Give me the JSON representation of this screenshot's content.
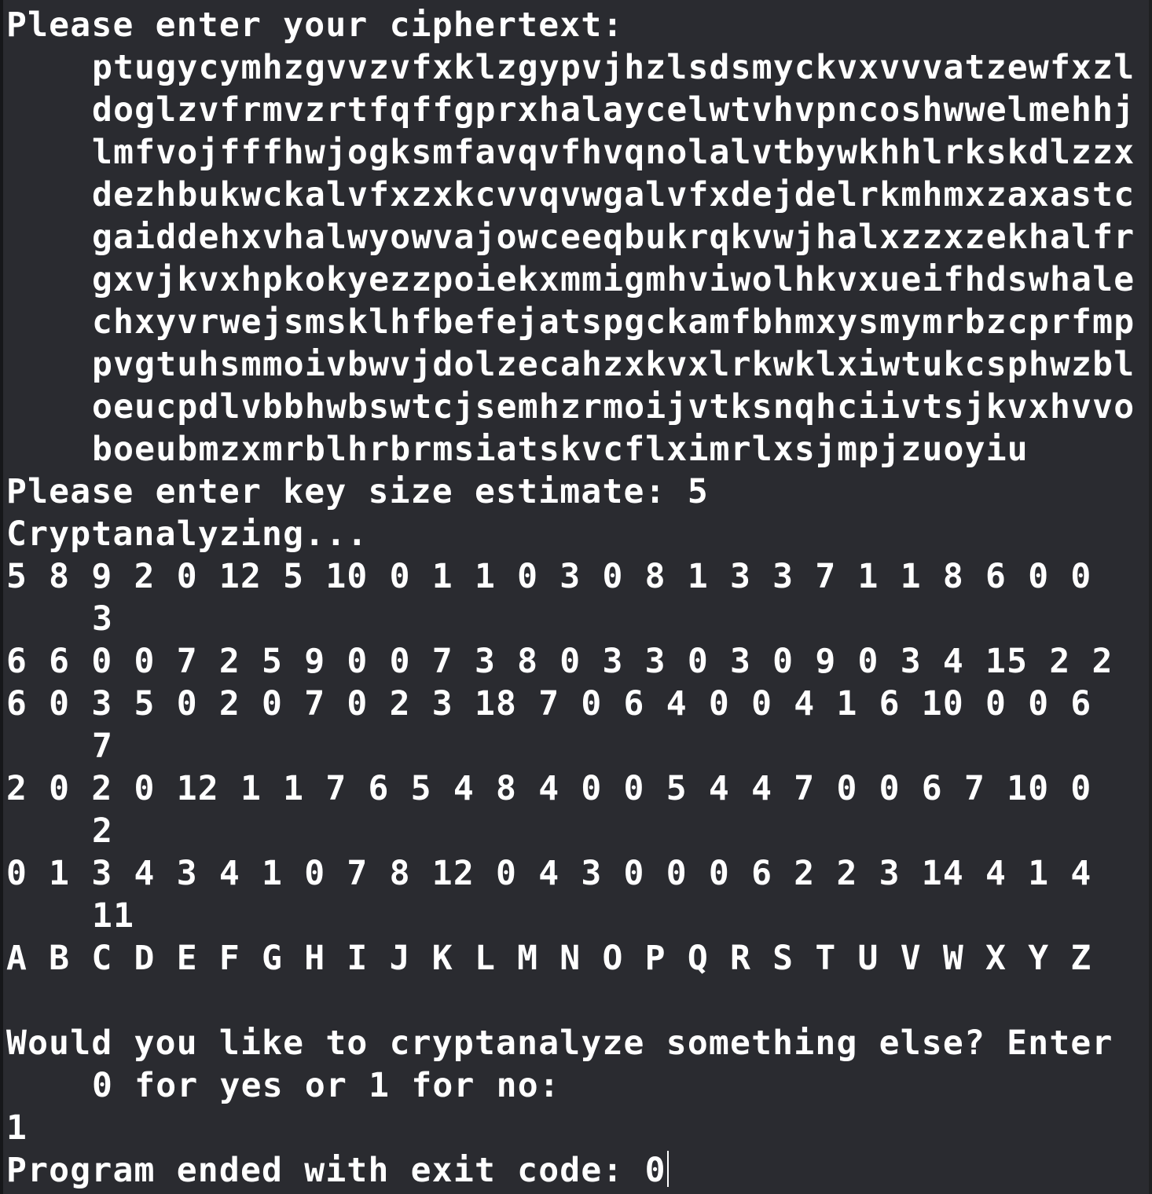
{
  "console": {
    "cipher_prompt": "Please enter your ciphertext:",
    "ciphertext_lines": [
      "ptugycymhzgvvzvfxklzgypvjhzlsdsmyckvxvvvatzewfxzl",
      "doglzvfrmvzrtfqffgprxhalaycelwtvhvpncoshwwelmehhj",
      "lmfvojfffhwjogksmfavqvfhvqnolalvtbywkhhlrkskdlzzx",
      "dezhbukwckalvfxzxkcvvqvwgalvfxdejdelrkmhmxzaxastc",
      "gaiddehxvhalwyowvajowceeqbukrqkvwjhalxzzxzekhalfr",
      "gxvjkvxhpkokyezzpoiekxmmigmhviwolhkvxueifhdswhale",
      "chxyvrwejsmsklhfbefejatspgckamfbhmxysmymrbzcprfmp",
      "pvgtuhsmmoivbwvjdolzecahzxkvxlrkwklxiwtukcsphwzbl",
      "oeucpdlvbbhwbswtcjsemhzrmoijvtksnqhciivtsjkvxhvvo",
      "boeubmzxmrblhrbrmsiatskvcflximrlxsjmpjzuoyiu"
    ],
    "keysize_prompt": "Please enter key size estimate: 5",
    "analyzing": "Cryptanalyzing...",
    "count_lines": [
      "5 8 9 2 0 12 5 10 0 1 1 0 3 0 8 1 3 3 7 1 1 8 6 0 0",
      "3",
      "6 6 0 0 7 2 5 9 0 0 7 3 8 0 3 3 0 3 0 9 0 3 4 15 2 2",
      "6 0 3 5 0 2 0 7 0 2 3 18 7 0 6 4 0 0 4 1 6 10 0 0 6",
      "7",
      "2 0 2 0 12 1 1 7 6 5 4 8 4 0 0 5 4 4 7 0 0 6 7 10 0",
      "2",
      "0 1 3 4 3 4 1 0 7 8 12 0 4 3 0 0 0 6 2 2 3 14 4 1 4",
      "11"
    ],
    "alphabet": "A B C D E F G H I J K L M N O P Q R S T U V W X Y Z",
    "again_prompt_1": "Would you like to cryptanalyze something else? Enter",
    "again_prompt_2": "0 for yes or 1 for no:",
    "answer": "1",
    "exit_message": "Program ended with exit code: 0"
  }
}
